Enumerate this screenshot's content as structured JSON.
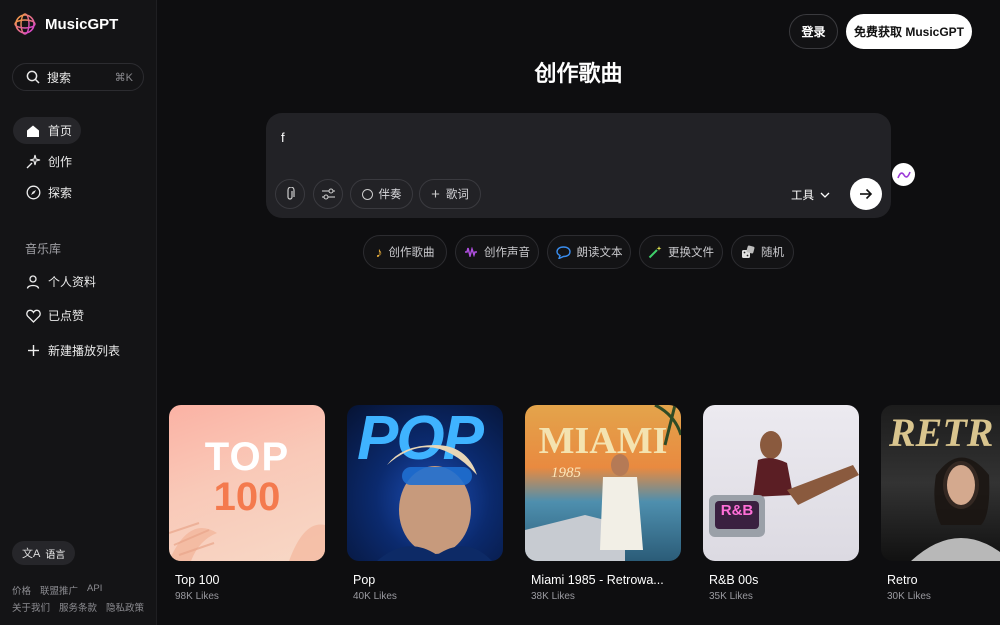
{
  "app": {
    "name": "MusicGPT"
  },
  "sidebar": {
    "search_label": "搜索",
    "search_shortcut": "⌘K",
    "nav": [
      {
        "label": "首页",
        "icon": "home-icon"
      },
      {
        "label": "创作",
        "icon": "sparkle-icon"
      },
      {
        "label": "探索",
        "icon": "compass-icon"
      }
    ],
    "library_title": "音乐库",
    "library": [
      {
        "label": "个人资料",
        "icon": "user-icon"
      },
      {
        "label": "已点赞",
        "icon": "heart-icon"
      },
      {
        "label": "新建播放列表",
        "icon": "plus-icon"
      }
    ],
    "language_label": "语言",
    "footer_row1": [
      "价格",
      "联盟推广",
      "API"
    ],
    "footer_row2": [
      "关于我们",
      "服务条款",
      "隐私政策"
    ]
  },
  "header": {
    "login_label": "登录",
    "signup_label": "免费获取 MusicGPT"
  },
  "main": {
    "title": "创作歌曲",
    "composer": {
      "text": "f",
      "accompaniment_label": "伴奏",
      "lyrics_label": "歌词",
      "tools_label": "工具"
    },
    "chips": [
      {
        "label": "创作歌曲",
        "icon": "music-note-icon",
        "color": "#f0b33c"
      },
      {
        "label": "创作声音",
        "icon": "waveform-icon",
        "color": "#b04fe0"
      },
      {
        "label": "朗读文本",
        "icon": "speech-bubble-icon",
        "color": "#3a8ef0"
      },
      {
        "label": "更换文件",
        "icon": "magic-wand-icon",
        "color": "#3fd06a"
      },
      {
        "label": "随机",
        "icon": "dice-icon",
        "color": "#e0e0e0"
      }
    ],
    "playlists": [
      {
        "name": "Top 100",
        "likes": "98K Likes",
        "cover_text": [
          "TOP",
          "100"
        ]
      },
      {
        "name": "Pop",
        "likes": "40K Likes",
        "cover_text": [
          "POP"
        ]
      },
      {
        "name": "Miami 1985 - Retrowa...",
        "likes": "38K Likes",
        "cover_text": [
          "MIAMI",
          "1985"
        ]
      },
      {
        "name": "R&B 00s",
        "likes": "35K Likes",
        "cover_text": [
          "R&B"
        ]
      },
      {
        "name": "Retro",
        "likes": "30K Likes",
        "cover_text": [
          "RETR"
        ]
      }
    ]
  }
}
